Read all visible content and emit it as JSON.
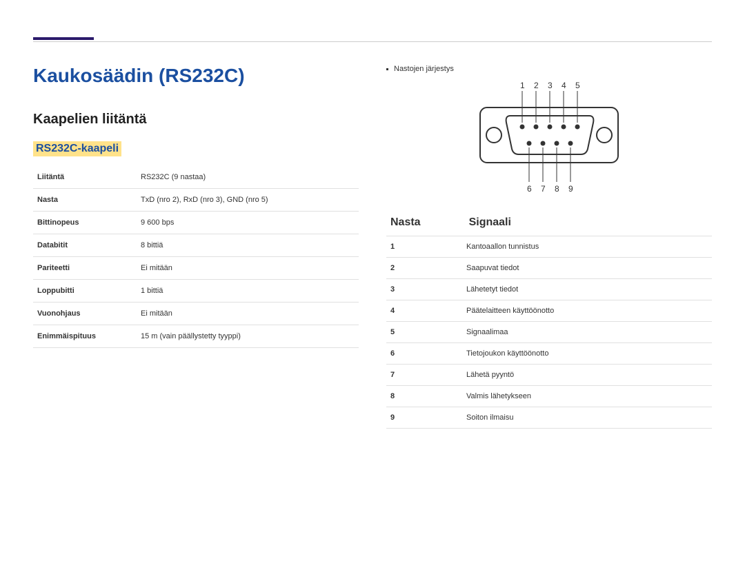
{
  "title": "Kaukosäädin (RS232C)",
  "section": "Kaapelien liitäntä",
  "subsection": "RS232C-kaapeli",
  "specs": [
    {
      "label": "Liitäntä",
      "value": "RS232C (9 nastaa)"
    },
    {
      "label": "Nasta",
      "value": "TxD (nro 2), RxD (nro 3), GND (nro 5)"
    },
    {
      "label": "Bittinopeus",
      "value": "9 600 bps"
    },
    {
      "label": "Databitit",
      "value": "8 bittiä"
    },
    {
      "label": "Pariteetti",
      "value": "Ei mitään"
    },
    {
      "label": "Loppubitti",
      "value": "1 bittiä"
    },
    {
      "label": "Vuonohjaus",
      "value": "Ei mitään"
    },
    {
      "label": "Enimmäispituus",
      "value": "15 m (vain päällystetty tyyppi)"
    }
  ],
  "pin_order_label": "Nastojen järjestys",
  "pin_labels_top": [
    "1",
    "2",
    "3",
    "4",
    "5"
  ],
  "pin_labels_bottom": [
    "6",
    "7",
    "8",
    "9"
  ],
  "signal_head": {
    "pin": "Nasta",
    "sig": "Signaali"
  },
  "signals": [
    {
      "n": "1",
      "s": "Kantoaallon tunnistus"
    },
    {
      "n": "2",
      "s": "Saapuvat tiedot"
    },
    {
      "n": "3",
      "s": "Lähetetyt tiedot"
    },
    {
      "n": "4",
      "s": "Päätelaitteen käyttöönotto"
    },
    {
      "n": "5",
      "s": "Signaalimaa"
    },
    {
      "n": "6",
      "s": "Tietojoukon käyttöönotto"
    },
    {
      "n": "7",
      "s": "Lähetä pyyntö"
    },
    {
      "n": "8",
      "s": "Valmis lähetykseen"
    },
    {
      "n": "9",
      "s": "Soiton ilmaisu"
    }
  ]
}
